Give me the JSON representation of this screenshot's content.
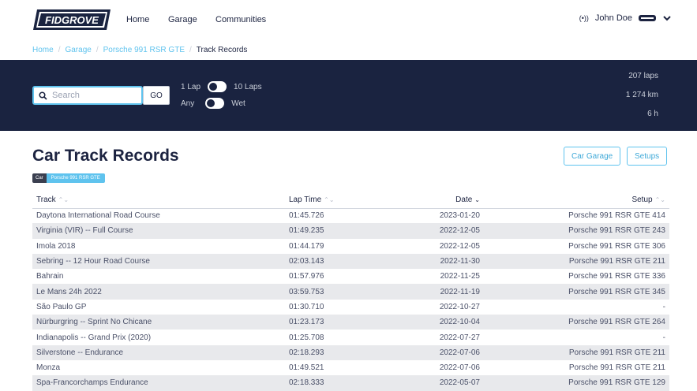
{
  "nav": {
    "logo_text": "FIDGROVE",
    "links": [
      "Home",
      "Garage",
      "Communities"
    ],
    "user_name": "John Doe"
  },
  "breadcrumb": {
    "items": [
      "Home",
      "Garage",
      "Porsche 991 RSR GTE"
    ],
    "current": "Track Records"
  },
  "filters": {
    "search_placeholder": "Search",
    "go_label": "GO",
    "toggle_1_left": "1 Lap",
    "toggle_1_right": "10 Laps",
    "toggle_2_left": "Any",
    "toggle_2_right": "Wet"
  },
  "stats": {
    "laps": "207 laps",
    "distance": "1 274 km",
    "time": "6 h"
  },
  "page": {
    "title": "Car Track Records",
    "chip_key": "Car",
    "chip_value": "Porsche 991 RSR GTE",
    "car_garage_label": "Car Garage",
    "setups_label": "Setups"
  },
  "table": {
    "headers": [
      "Track",
      "Lap Time",
      "Date",
      "Setup"
    ],
    "rows": [
      [
        "Daytona International Road Course",
        "01:45.726",
        "2023-01-20",
        "Porsche 991 RSR GTE 414"
      ],
      [
        "Virginia (VIR) -- Full Course",
        "01:49.235",
        "2022-12-05",
        "Porsche 991 RSR GTE 243"
      ],
      [
        "Imola 2018",
        "01:44.179",
        "2022-12-05",
        "Porsche 991 RSR GTE 306"
      ],
      [
        "Sebring -- 12 Hour Road Course",
        "02:03.143",
        "2022-11-30",
        "Porsche 991 RSR GTE 211"
      ],
      [
        "Bahrain",
        "01:57.976",
        "2022-11-25",
        "Porsche 991 RSR GTE 336"
      ],
      [
        "Le Mans 24h 2022",
        "03:59.753",
        "2022-11-19",
        "Porsche 991 RSR GTE 345"
      ],
      [
        "São Paulo GP",
        "01:30.710",
        "2022-10-27",
        "-"
      ],
      [
        "Nürburgring -- Sprint No Chicane",
        "01:23.173",
        "2022-10-04",
        "Porsche 991 RSR GTE 264"
      ],
      [
        "Indianapolis -- Grand Prix (2020)",
        "01:25.708",
        "2022-07-27",
        "-"
      ],
      [
        "Silverstone -- Endurance",
        "02:18.293",
        "2022-07-06",
        "Porsche 991 RSR GTE 211"
      ],
      [
        "Monza",
        "01:49.521",
        "2022-07-06",
        "Porsche 991 RSR GTE 211"
      ],
      [
        "Spa-Francorchamps Endurance",
        "02:18.333",
        "2022-05-07",
        "Porsche 991 RSR GTE 129"
      ]
    ]
  },
  "icons": {
    "logo": "fidgrove-logo",
    "radio": "radio-icon",
    "car": "car-icon",
    "chevron": "chevron-down-icon",
    "search": "search-icon",
    "sort": "sort-icon"
  },
  "colors": {
    "navy": "#1a2340",
    "accent": "#5fc3ee",
    "row_alt": "#e8e9ec"
  }
}
